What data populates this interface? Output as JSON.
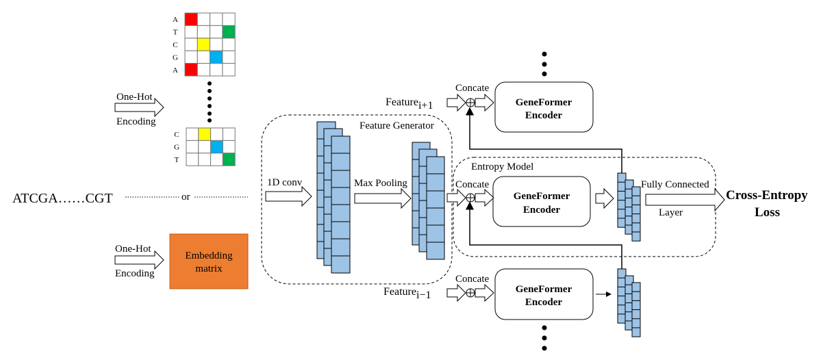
{
  "colors": {
    "red": "#FF0000",
    "green": "#00B050",
    "yellow": "#FFFF00",
    "blue": "#00B0F0",
    "feature_blue": "#9DC3E6",
    "embedding": "#ED7D31"
  },
  "onehot_top": {
    "rows": [
      "A",
      "T",
      "C",
      "G",
      "A"
    ],
    "hot": [
      0,
      3,
      1,
      2,
      0
    ],
    "colors": [
      "red",
      "green",
      "yellow",
      "blue",
      "red"
    ]
  },
  "onehot_bottom": {
    "rows": [
      "C",
      "G",
      "T"
    ],
    "hot": [
      1,
      2,
      3
    ],
    "colors": [
      "yellow",
      "blue",
      "green"
    ]
  },
  "labels": {
    "onehot1": "One-Hot",
    "encoding1": "Encoding",
    "onehot2": "One-Hot",
    "encoding2": "Encoding",
    "sequence": "ATCGA……CGT",
    "or": "or",
    "embedding1": "Embedding",
    "embedding2": "matrix",
    "feature_generator": "Feature Generator",
    "conv": "1D conv",
    "pool": "Max Pooling",
    "entropy_model": "Entropy Model",
    "concate_top": "Concate",
    "concate_mid": "Concate",
    "concate_bot": "Concate",
    "feature_top": "Feature",
    "feature_top_sub": "i+1",
    "feature_bot": "Feature",
    "feature_bot_sub": "i−1",
    "enc_a1": "GeneFormer",
    "enc_a2": "Encoder",
    "enc_b1": "GeneFormer",
    "enc_b2": "Encoder",
    "enc_c1": "GeneFormer",
    "enc_c2": "Encoder",
    "fc1": "Fully Connected",
    "fc2": "Layer",
    "loss1": "Cross-Entropy",
    "loss2": "Loss"
  }
}
